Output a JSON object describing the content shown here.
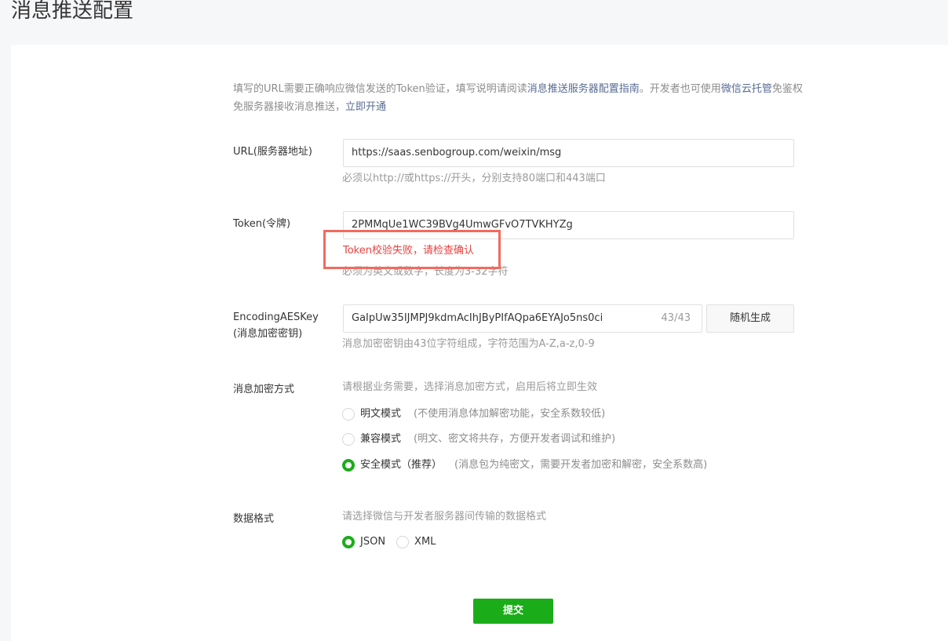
{
  "page": {
    "title": "消息推送配置"
  },
  "intro": {
    "part1": "填写的URL需要正确响应微信发送的Token验证，填写说明请阅读",
    "link1": "消息推送服务器配置指南",
    "part2": "。开发者也可使用",
    "link2": "微信云托管",
    "part3": "免鉴权免服务器接收消息推送，",
    "link3": "立即开通"
  },
  "url_field": {
    "label": "URL(服务器地址)",
    "value": "https://saas.senbogroup.com/weixin/msg",
    "hint": "必须以http://或https://开头，分别支持80端口和443端口"
  },
  "token_field": {
    "label": "Token(令牌)",
    "value": "2PMMqUe1WC39BVg4UmwGFvO7TVKHYZg",
    "error": "Token校验失败，请检查确认",
    "hint": "必须为英文或数字，长度为3-32字符"
  },
  "aes_field": {
    "label_line1": "EncodingAESKey",
    "label_line2": "(消息加密密钥)",
    "value": "GaIpUw35IJMPJ9kdmAcIhJByPIfAQpa6EYAJo5ns0ci",
    "counter": "43/43",
    "generate_label": "随机生成",
    "hint": "消息加密密钥由43位字符组成，字符范围为A-Z,a-z,0-9"
  },
  "encrypt_mode": {
    "label": "消息加密方式",
    "hint": "请根据业务需要，选择消息加密方式，启用后将立即生效",
    "options": [
      {
        "label": "明文模式",
        "desc": "(不使用消息体加解密功能，安全系数较低)",
        "checked": false
      },
      {
        "label": "兼容模式",
        "desc": "(明文、密文将共存，方便开发者调试和维护)",
        "checked": false
      },
      {
        "label": "安全模式（推荐）",
        "desc": "(消息包为纯密文，需要开发者加密和解密，安全系数高)",
        "checked": true
      }
    ]
  },
  "data_format": {
    "label": "数据格式",
    "hint": "请选择微信与开发者服务器间传输的数据格式",
    "options": [
      {
        "label": "JSON",
        "checked": true
      },
      {
        "label": "XML",
        "checked": false
      }
    ]
  },
  "submit": {
    "label": "提交"
  },
  "colors": {
    "accent": "#1aad19",
    "error": "#e64340",
    "link": "#576b95"
  }
}
